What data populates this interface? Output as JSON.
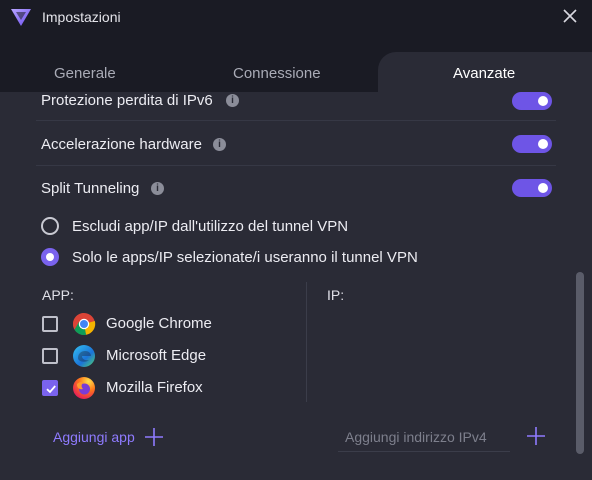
{
  "window": {
    "title": "Impostazioni"
  },
  "tabs": [
    {
      "label": "Generale",
      "active": false
    },
    {
      "label": "Connessione",
      "active": false
    },
    {
      "label": "Avanzate",
      "active": true
    }
  ],
  "settings": [
    {
      "label": "Protezione perdita di IPv6",
      "enabled": true
    },
    {
      "label": "Accelerazione hardware",
      "enabled": true
    },
    {
      "label": "Split Tunneling",
      "enabled": true
    }
  ],
  "split_tunneling": {
    "options": [
      {
        "label": "Escludi app/IP dall'utilizzo del tunnel VPN",
        "selected": false
      },
      {
        "label": "Solo le apps/IP selezionate/i useranno il tunnel VPN",
        "selected": true
      }
    ],
    "apps_label": "APP:",
    "ip_label": "IP:",
    "apps": [
      {
        "name": "Google Chrome",
        "icon": "chrome-icon",
        "checked": false
      },
      {
        "name": "Microsoft Edge",
        "icon": "edge-icon",
        "checked": false
      },
      {
        "name": "Mozilla Firefox",
        "icon": "firefox-icon",
        "checked": true
      }
    ],
    "add_app_label": "Aggiungi app",
    "ipv4_placeholder": "Aggiungi indirizzo IPv4"
  },
  "colors": {
    "accent": "#7a63ee",
    "background": "#2a2b36",
    "titlebar": "#1a1b24",
    "link": "#8f7bff"
  }
}
